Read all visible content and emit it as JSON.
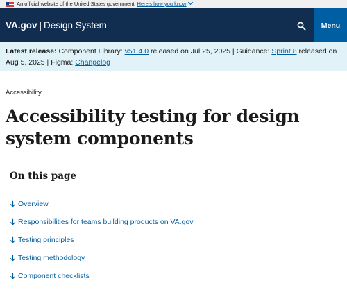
{
  "gov_banner": {
    "text": "An official website of the United States government",
    "link": "Here's how you know"
  },
  "header": {
    "logo_main": "VA.gov",
    "logo_separator": "|",
    "logo_sub": "Design System",
    "search_icon": "search-icon",
    "menu_label": "Menu",
    "colors": {
      "header_bg": "#112e51",
      "menu_bg": "#005ea2"
    }
  },
  "release": {
    "label": "Latest release:",
    "component_library_text": "Component Library:",
    "component_library_version": "v51.4.0",
    "released_text_1": "released on Jul 25, 2025 | Guidance:",
    "guidance_link": "Sprint 8",
    "released_text_2": "released on Aug 5, 2025 | Figma:",
    "figma_link": "Changelog"
  },
  "main": {
    "breadcrumb": "Accessibility",
    "title": "Accessibility testing for design system components",
    "on_this_page": {
      "title": "On this page",
      "items": [
        {
          "label": "Overview"
        },
        {
          "label": "Responsibilities for teams building products on VA.gov"
        },
        {
          "label": "Testing principles"
        },
        {
          "label": "Testing methodology"
        },
        {
          "label": "Component checklists"
        }
      ]
    }
  },
  "colors": {
    "link": "#005ea2",
    "release_bg": "#e1f3f8",
    "text": "#1b1b1b"
  }
}
